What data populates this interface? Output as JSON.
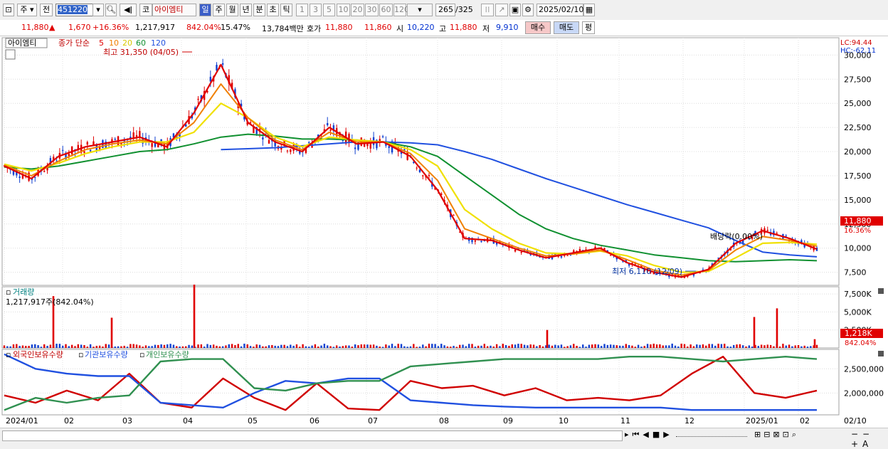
{
  "toolbar": {
    "market_label": "주",
    "prev_label": "전",
    "code_value": "451220",
    "stock_button": "코",
    "stock_name": "아이엠티",
    "periods": [
      "일",
      "주",
      "월",
      "년",
      "분",
      "초",
      "틱"
    ],
    "intervals": [
      "1",
      "3",
      "5",
      "10",
      "20",
      "30",
      "60",
      "120"
    ],
    "count_display": "265",
    "count_total": "/325",
    "date_value": "2025/02/10"
  },
  "quote": {
    "price": "11,880",
    "change_arrow": "▲",
    "change": "1,670",
    "change_pct": "+16.36%",
    "volume": "1,217,917",
    "volume_ratio": "842.04%",
    "turnover": "15.47%",
    "amount": "13,784백만",
    "ask_label": "호가",
    "ask": "11,880",
    "bid": "11,860",
    "open_label": "시",
    "open": "10,220",
    "high_label": "고",
    "high": "11,880",
    "low_label": "저",
    "low": "9,910",
    "buy_button": "매수",
    "sell_button": "매도",
    "avg_button": "평"
  },
  "colors": {
    "up": "#e00000",
    "down": "#1040d0",
    "ma5": "#e00000",
    "ma10": "#f08000",
    "ma20": "#f0e000",
    "ma60": "#109030",
    "ma120": "#2050e0",
    "foreign": "#d00000",
    "institution": "#2050e0",
    "individual": "#309050"
  },
  "price_panel": {
    "name_tag": "아이엠티",
    "legend_prefix": "종가 단순",
    "ma_labels": [
      "5",
      "10",
      "20",
      "60",
      "120"
    ],
    "high_note": "최고 31,350 (04/05)",
    "low_note": "최저 6,110 (12/09)",
    "dividend_note": "배당락(0.00%)",
    "lc": "LC:94.44",
    "hc": "HC:-62.11",
    "current_tag": "11,880",
    "current_pct_tag": "16.36%"
  },
  "volume_panel": {
    "title": "거래량",
    "info": "1,217,917주(842.04%)",
    "current_tag": "1,218K",
    "current_pct_tag": "842.04%"
  },
  "holding_panel": {
    "legend": [
      "외국인보유수량",
      "기관보유수량",
      "개인보유수량"
    ]
  },
  "x_axis": {
    "labels": [
      "2024/01",
      "02",
      "03",
      "04",
      "05",
      "06",
      "07",
      "08",
      "09",
      "10",
      "11",
      "12",
      "2025/01",
      "02"
    ],
    "last_label": "02/10"
  },
  "chart_data": [
    {
      "type": "line",
      "title": "아이엠티 일봉",
      "y_ticks": [
        "30,000",
        "27,500",
        "25,000",
        "22,500",
        "20,000",
        "17,500",
        "15,000",
        "12,500",
        "10,000",
        "7,500"
      ],
      "ylim": [
        6000,
        31500
      ],
      "x_months": [
        "2024/01",
        "02",
        "03",
        "04",
        "05",
        "06",
        "07",
        "08",
        "09",
        "10",
        "11",
        "12",
        "2025/01",
        "02"
      ],
      "series": [
        {
          "name": "5",
          "values": [
            18500,
            17200,
            19500,
            20500,
            21000,
            21500,
            20500,
            24000,
            29000,
            23000,
            21000,
            20000,
            22500,
            20800,
            21000,
            19500,
            16000,
            11000,
            10800,
            9800,
            9000,
            9500,
            10000,
            8500,
            7500,
            7000,
            7800,
            10500,
            11800,
            11000,
            9900
          ]
        },
        {
          "name": "10",
          "values": [
            18600,
            17500,
            19000,
            20200,
            20800,
            21200,
            20800,
            23000,
            27000,
            23500,
            21200,
            20200,
            22000,
            21000,
            21000,
            19800,
            17000,
            12000,
            11000,
            10000,
            9200,
            9400,
            9800,
            8800,
            7700,
            7200,
            7700,
            9800,
            11200,
            10800,
            10200
          ]
        },
        {
          "name": "20",
          "values": [
            18700,
            18000,
            18800,
            19800,
            20500,
            21000,
            21000,
            22000,
            25000,
            23500,
            21500,
            20500,
            21500,
            21200,
            21000,
            20200,
            18500,
            14000,
            12000,
            10500,
            9500,
            9400,
            9700,
            9200,
            8200,
            7500,
            7600,
            9000,
            10500,
            10600,
            10400
          ]
        },
        {
          "name": "60",
          "values": [
            18400,
            18200,
            18500,
            19000,
            19500,
            20000,
            20200,
            20800,
            21500,
            21800,
            21600,
            21300,
            21300,
            21200,
            21000,
            20500,
            19500,
            17500,
            15500,
            13500,
            12000,
            11000,
            10300,
            9800,
            9300,
            9000,
            8700,
            8600,
            8700,
            8800,
            8700
          ]
        },
        {
          "name": "120",
          "values": [
            null,
            null,
            null,
            null,
            null,
            null,
            null,
            null,
            20200,
            20300,
            20400,
            20600,
            20800,
            21000,
            21000,
            20900,
            20700,
            20000,
            19200,
            18200,
            17200,
            16300,
            15400,
            14500,
            13700,
            12900,
            12100,
            10800,
            9600,
            9300,
            9100
          ]
        }
      ]
    },
    {
      "type": "bar",
      "title": "거래량",
      "y_ticks": [
        "7,500K",
        "5,000K",
        "2,500K"
      ],
      "ylim": [
        0,
        8500
      ],
      "unit": "K",
      "peaks": [
        {
          "month": "2024/01",
          "value": 7200
        },
        {
          "month": "03",
          "value": 4200
        },
        {
          "month": "04",
          "value": 8800
        },
        {
          "month": "10",
          "value": 2500
        },
        {
          "month": "2025/01",
          "value": 4300
        },
        {
          "month": "2025/01",
          "value": 5500
        },
        {
          "month": "02",
          "value": 1218
        }
      ]
    },
    {
      "type": "line",
      "title": "보유수량",
      "y_ticks": [
        "2,500,000",
        "2,000,000"
      ],
      "series": [
        {
          "name": "외국인보유수량",
          "values": [
            1950000,
            1800000,
            2050000,
            1850000,
            2400000,
            1800000,
            1700000,
            2300000,
            1900000,
            1650000,
            2200000,
            1680000,
            1650000,
            2250000,
            2100000,
            2150000,
            1950000,
            2100000,
            1850000,
            1900000,
            1850000,
            1950000,
            2400000,
            2750000,
            2000000,
            1900000,
            2050000
          ]
        },
        {
          "name": "기관보유수량",
          "values": [
            2800000,
            2500000,
            2400000,
            2350000,
            2350000,
            1800000,
            1750000,
            1700000,
            2000000,
            2250000,
            2200000,
            2300000,
            2300000,
            1850000,
            1800000,
            1750000,
            1720000,
            1700000,
            1700000,
            1700000,
            1700000,
            1700000,
            1650000,
            1650000,
            1650000,
            1650000,
            1650000
          ]
        },
        {
          "name": "개인보유수량",
          "values": [
            1650000,
            1900000,
            1800000,
            1900000,
            1950000,
            2650000,
            2700000,
            2700000,
            2100000,
            2050000,
            2200000,
            2250000,
            2250000,
            2550000,
            2600000,
            2650000,
            2700000,
            2700000,
            2700000,
            2700000,
            2750000,
            2750000,
            2700000,
            2650000,
            2700000,
            2750000,
            2700000
          ]
        }
      ]
    }
  ]
}
